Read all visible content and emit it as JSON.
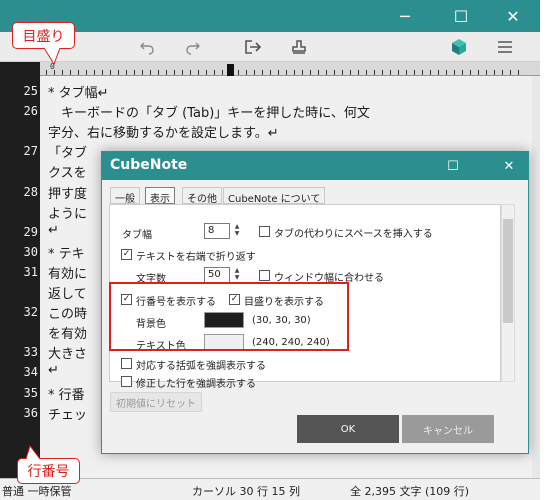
{
  "annotations": {
    "ruler_callout": "目盛り",
    "line_number_callout": "行番号"
  },
  "window": {
    "buttons": {
      "minimize": "─",
      "maximize": "☐",
      "close": "✕"
    }
  },
  "toolbar": {
    "icons": [
      "undo-icon",
      "redo-icon",
      "export-icon",
      "stamp-icon",
      "cube-icon",
      "menu-icon"
    ]
  },
  "ruler": {
    "zero_label": "0"
  },
  "editor": {
    "line_numbers": [
      "25",
      "26",
      "",
      "27",
      "",
      "28",
      "",
      "29",
      "30",
      "31",
      "",
      "32",
      "",
      "33",
      "34",
      "35",
      "36"
    ],
    "lines": [
      "* タブ幅↵",
      "　キーボードの「タブ (Tab)」キーを押した時に、何文",
      "字分、右に移動するかを設定します。↵",
      "「タブ",
      "クスを",
      "押す度",
      "ように",
      "↵",
      "* テキ",
      "有効に",
      "返して",
      "この時",
      "を有効",
      "大きさ",
      "↵",
      "* 行番",
      "チェッ"
    ]
  },
  "statusbar": {
    "left_text": "普通 一時保管",
    "cursor": "カーソル 30 行 15 列",
    "count": "全 2,395 文字 (109 行)"
  },
  "dialog": {
    "title": "CubeNote",
    "buttons": {
      "maximize": "☐",
      "close": "✕"
    },
    "tabs": [
      "一般",
      "表示",
      "その他",
      "CubeNote について"
    ],
    "active_tab": "表示",
    "tab_width_label": "タブ幅",
    "tab_width_value": "8",
    "use_spaces_label": "タブの代わりにスペースを挿入する",
    "wrap_label": "テキストを右端で折り返す",
    "chars_label": "文字数",
    "chars_value": "50",
    "fit_window_label": "ウィンドウ幅に合わせる",
    "show_line_numbers_label": "行番号を表示する",
    "show_ruler_label": "目盛りを表示する",
    "bg_color_label": "背景色",
    "bg_color_value": "(30, 30, 30)",
    "text_color_label": "テキスト色",
    "text_color_value": "(240, 240, 240)",
    "highlight_brackets_label": "対応する括弧を強調表示する",
    "highlight_modified_label": "修正した行を強調表示する",
    "reset_button": "初期値にリセット",
    "ok_button": "OK",
    "cancel_button": "キャンセル",
    "colors": {
      "bg": "#1e1e1e",
      "text": "#f0f0f0"
    }
  },
  "colors": {
    "accent": "#2b8f8f",
    "annotation": "#e0201c"
  }
}
